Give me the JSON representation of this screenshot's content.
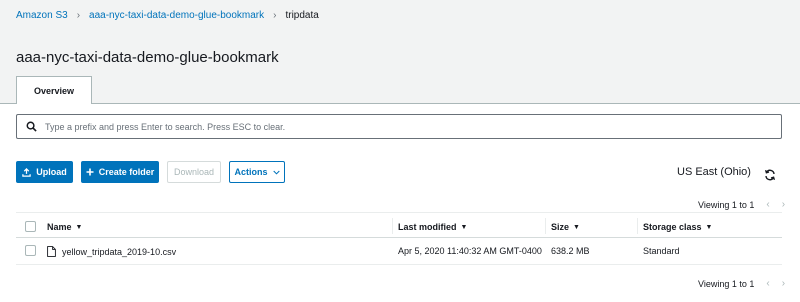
{
  "breadcrumb": {
    "root": "Amazon S3",
    "bucket": "aaa-nyc-taxi-data-demo-glue-bookmark",
    "folder": "tripdata",
    "separator": "›"
  },
  "page": {
    "title": "aaa-nyc-taxi-data-demo-glue-bookmark"
  },
  "tabs": [
    {
      "label": "Overview",
      "active": true
    }
  ],
  "search": {
    "placeholder": "Type a prefix and press Enter to search. Press ESC to clear.",
    "value": ""
  },
  "toolbar": {
    "upload_label": "Upload",
    "create_folder_label": "Create folder",
    "download_label": "Download",
    "actions_label": "Actions"
  },
  "region": {
    "label": "US East (Ohio)"
  },
  "pagination": {
    "text": "Viewing 1 to 1"
  },
  "table": {
    "columns": [
      "Name",
      "Last modified",
      "Size",
      "Storage class"
    ],
    "rows": [
      {
        "name": "yellow_tripdata_2019-10.csv",
        "last_modified": "Apr 5, 2020 11:40:32 AM GMT-0400",
        "size": "638.2 MB",
        "storage_class": "Standard"
      }
    ]
  },
  "colors": {
    "accent": "#0073bb",
    "background": "#f2f3f3",
    "border": "#aab7b8"
  },
  "icons": [
    "search-icon",
    "upload-icon",
    "plus-icon",
    "chevron-down-icon",
    "refresh-icon",
    "file-icon",
    "chevron-left-icon",
    "chevron-right-icon",
    "sort-caret-icon"
  ]
}
